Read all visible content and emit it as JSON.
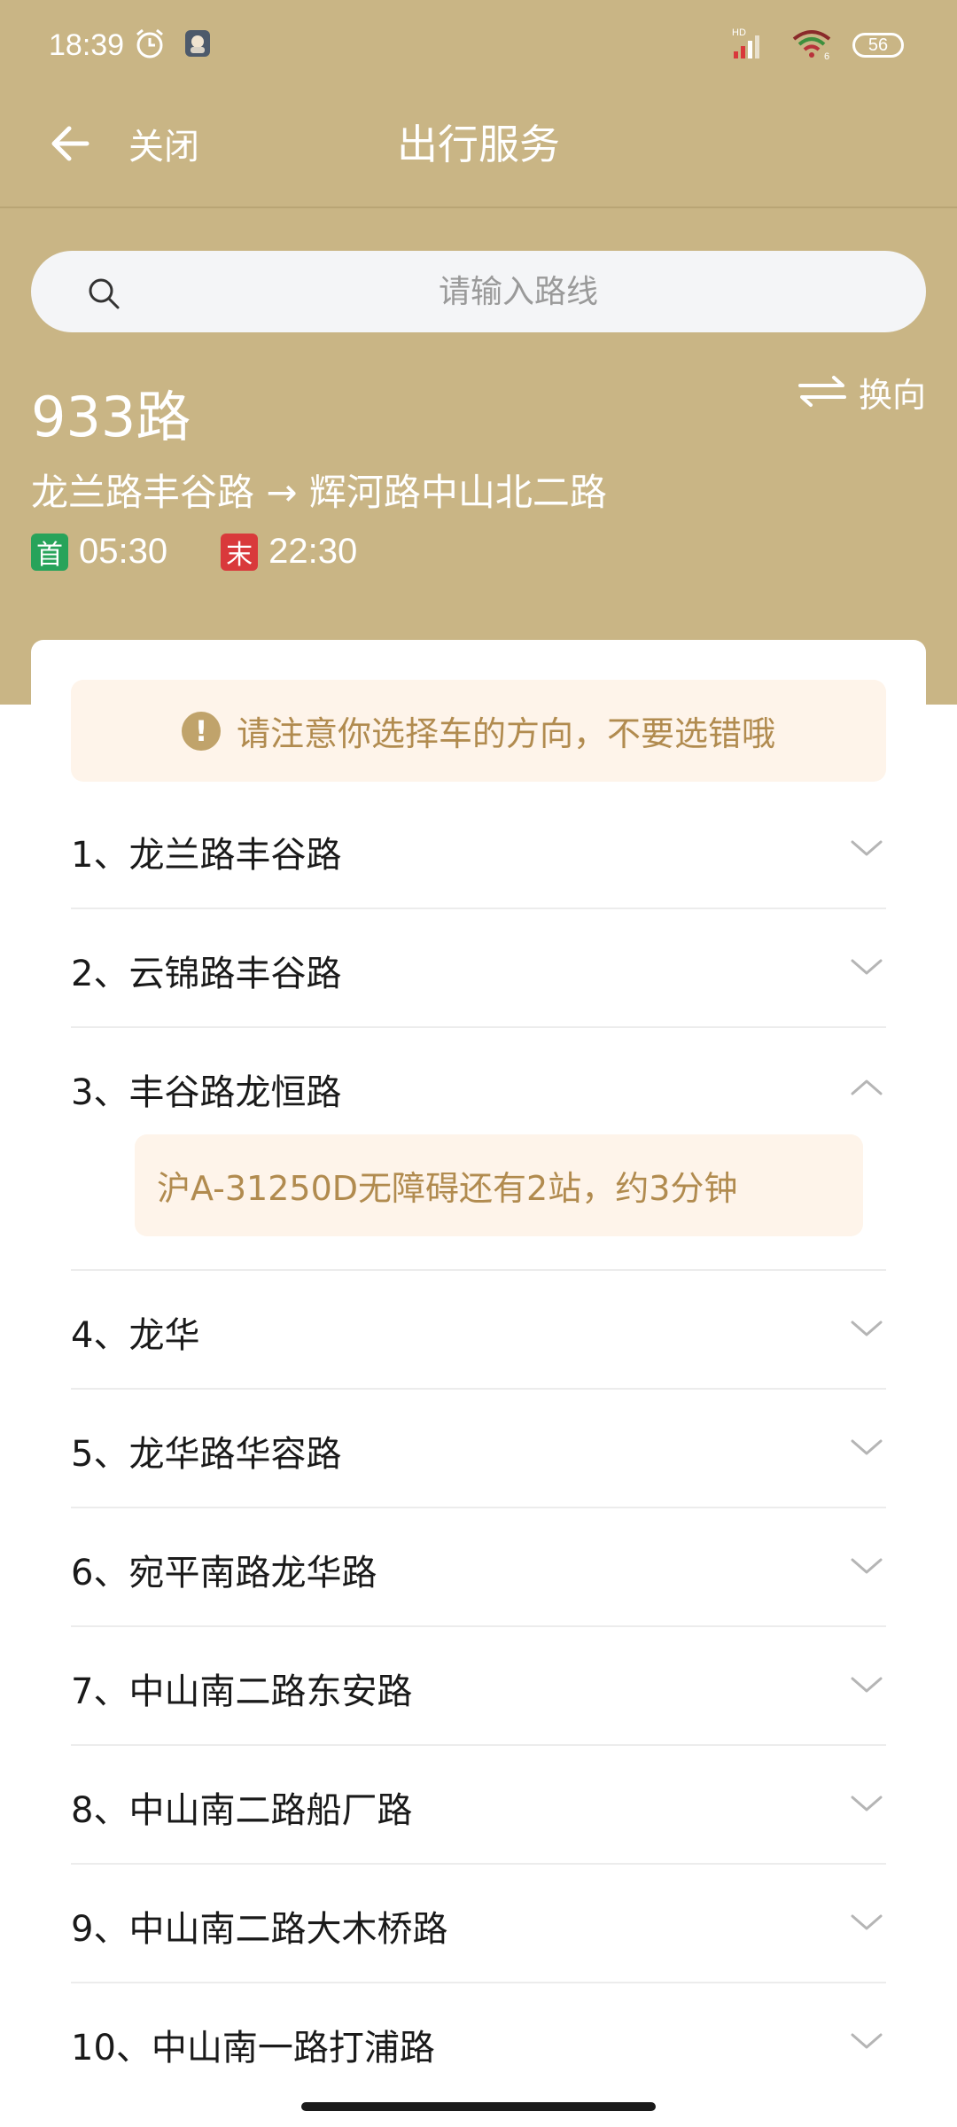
{
  "status_bar": {
    "time": "18:39",
    "battery": "56",
    "network": "HD",
    "wifi_badge": "6"
  },
  "nav": {
    "close_label": "关闭",
    "title": "出行服务"
  },
  "search": {
    "placeholder": "请输入路线"
  },
  "route": {
    "number": "933路",
    "switch_label": "换向",
    "path": "龙兰路丰谷路 → 辉河路中山北二路",
    "first_badge": "首",
    "first_time": "05:30",
    "last_badge": "末",
    "last_time": "22:30"
  },
  "notice": {
    "text": "请注意你选择车的方向，不要选错哦"
  },
  "stops": [
    {
      "label": "1、龙兰路丰谷路"
    },
    {
      "label": "2、云锦路丰谷路"
    },
    {
      "label": "3、丰谷路龙恒路",
      "bus_info": "沪A-31250D无障碍还有2站，约3分钟"
    },
    {
      "label": "4、龙华"
    },
    {
      "label": "5、龙华路华容路"
    },
    {
      "label": "6、宛平南路龙华路"
    },
    {
      "label": "7、中山南二路东安路"
    },
    {
      "label": "8、中山南二路船厂路"
    },
    {
      "label": "9、中山南二路大木桥路"
    },
    {
      "label": "10、中山南一路打浦路"
    }
  ],
  "colors": {
    "header_bg": "#c9b585",
    "accent_text": "#b18b4f",
    "notice_bg": "#fef4ea",
    "first_badge": "#27a35a",
    "last_badge": "#d9393b"
  },
  "icons": [
    "alarm-icon",
    "app-notification-icon",
    "signal-icon",
    "wifi-icon",
    "battery-icon",
    "back-arrow-icon",
    "search-icon",
    "swap-direction-icon",
    "warning-icon",
    "chevron-down-icon",
    "chevron-up-icon"
  ]
}
